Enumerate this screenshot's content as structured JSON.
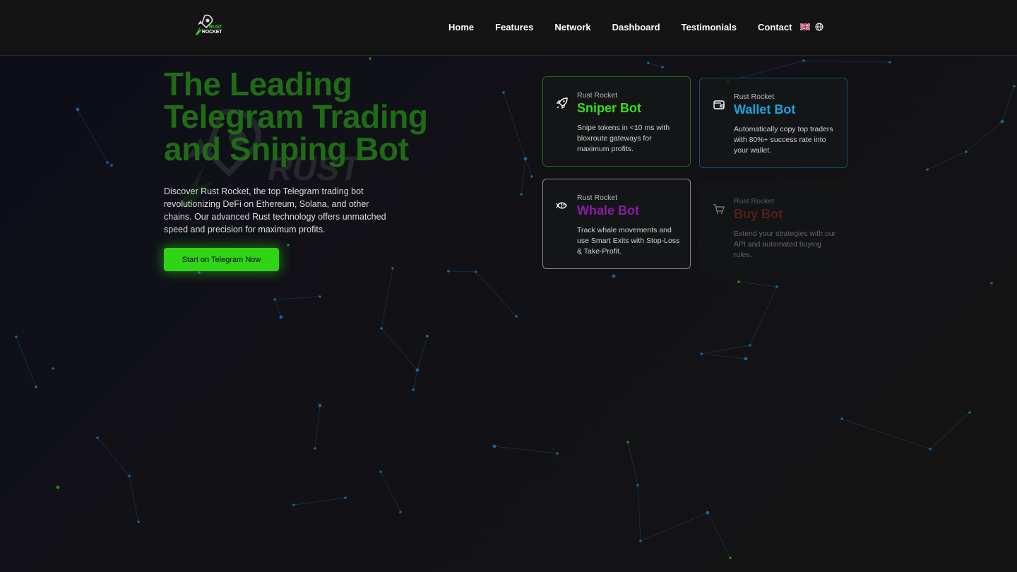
{
  "colors": {
    "accent_green": "#2fd415",
    "title_green": "#1f6b16",
    "sniper": "#33dd17",
    "wallet": "#1aa3dc",
    "whale": "#8d1aa6",
    "buy": "#b12a2a",
    "nav_bg": "#141414"
  },
  "nav": {
    "logo_icon": "rocket-logo-icon",
    "logo_line1": "RUST",
    "logo_line2": "ROCKET",
    "links": [
      "Home",
      "Features",
      "Network",
      "Dashboard",
      "Testimonials",
      "Contact"
    ],
    "lang_flag_icon": "uk-flag-icon",
    "globe_icon": "globe-icon"
  },
  "hero": {
    "title": "The Leading\nTelegram Trading\nand Sniping Bot",
    "description": "Discover Rust Rocket, the top Telegram trading bot revolutionizing DeFi on Ethereum, Solana, and other chains. Our advanced Rust technology offers unmatched speed and precision for maximum profits.",
    "cta": "Start on Telegram Now",
    "watermark_text": "RUST"
  },
  "cards": [
    {
      "brand": "Rust Rocket",
      "name": "Sniper Bot",
      "icon": "rocket-icon",
      "description": "Snipe tokens in <10 ms with bloxroute gateways for maximum profits."
    },
    {
      "brand": "Rust Rocket",
      "name": "Wallet Bot",
      "icon": "wallet-icon",
      "description": "Automatically copy top traders with 80%+ success rate into your wallet."
    },
    {
      "brand": "Rust Rocket",
      "name": "Whale Bot",
      "icon": "fish-icon",
      "description": "Track whale movements and use Smart Exits with Stop-Loss & Take-Profit."
    },
    {
      "brand": "Rust Rocket",
      "name": "Buy Bot",
      "icon": "cart-icon",
      "description": "Extend your strategies with our API and automated buying rules."
    }
  ]
}
